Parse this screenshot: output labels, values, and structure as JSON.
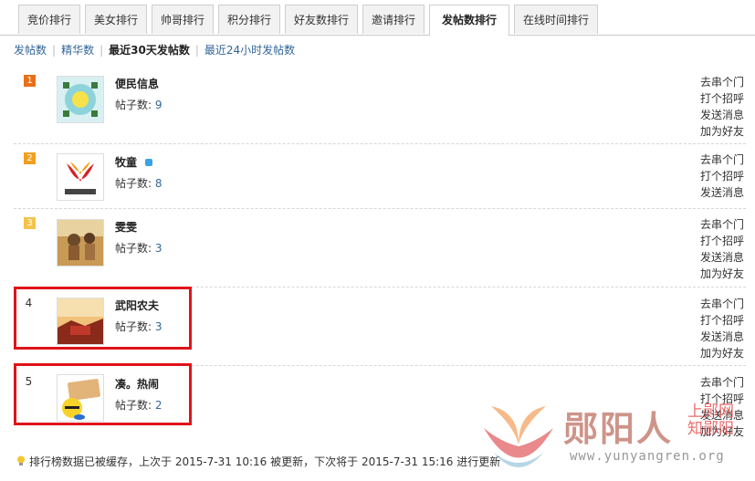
{
  "tabs": [
    {
      "label": "竞价排行"
    },
    {
      "label": "美女排行"
    },
    {
      "label": "帅哥排行"
    },
    {
      "label": "积分排行"
    },
    {
      "label": "好友数排行"
    },
    {
      "label": "邀请排行"
    },
    {
      "label": "发帖数排行",
      "active": true
    },
    {
      "label": "在线时间排行"
    }
  ],
  "subnav": {
    "items": [
      "发帖数",
      "精华数",
      "最近30天发帖数",
      "最近24小时发帖数"
    ],
    "active": "最近30天发帖数"
  },
  "rows": [
    {
      "rank": "1",
      "name": "便民信息",
      "posts_label": "帖子数:",
      "posts": "9",
      "actions": [
        "去串个门",
        "打个招呼",
        "发送消息",
        "加为好友"
      ]
    },
    {
      "rank": "2",
      "name": "牧童",
      "posts_label": "帖子数:",
      "posts": "8",
      "actions": [
        "去串个门",
        "打个招呼",
        "发送消息"
      ]
    },
    {
      "rank": "3",
      "name": "雯雯",
      "posts_label": "帖子数:",
      "posts": "3",
      "actions": [
        "去串个门",
        "打个招呼",
        "发送消息",
        "加为好友"
      ]
    },
    {
      "rank": "4",
      "name": "武阳农夫",
      "posts_label": "帖子数:",
      "posts": "3",
      "actions": [
        "去串个门",
        "打个招呼",
        "发送消息",
        "加为好友"
      ]
    },
    {
      "rank": "5",
      "name": "凑。热闹",
      "posts_label": "帖子数:",
      "posts": "2",
      "actions": [
        "去串个门",
        "打个招呼",
        "发送消息",
        "加为好友"
      ]
    }
  ],
  "footer": {
    "text": "排行榜数据已被缓存，上次于 2015-7-31 10:16 被更新，下次将于 2015-7-31 15:16 进行更新"
  },
  "watermark": {
    "brand": "郧阳人",
    "url": "www.yunyangren.org",
    "side": [
      "上郧网",
      "知郧阳"
    ]
  },
  "colors": {
    "link": "#336699",
    "highlight": "#e0131a",
    "rank1": "#e8701a",
    "rank2": "#f0a020",
    "rank3": "#f3c34a"
  }
}
